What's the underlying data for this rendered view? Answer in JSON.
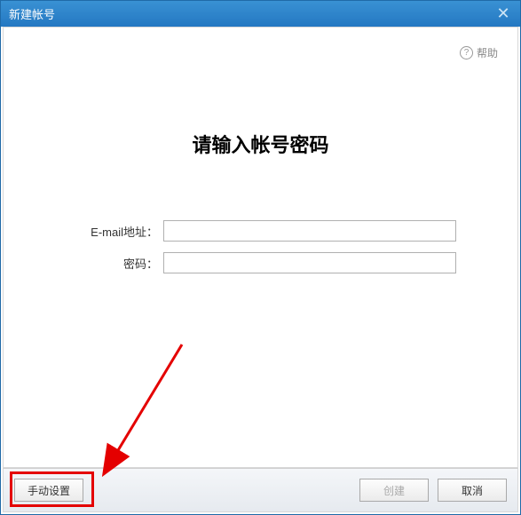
{
  "window": {
    "title": "新建帐号"
  },
  "help": {
    "label": "帮助"
  },
  "heading": "请输入帐号密码",
  "form": {
    "email_label": "E-mail地址：",
    "email_value": "",
    "password_label": "密码：",
    "password_value": ""
  },
  "buttons": {
    "manual": "手动设置",
    "create": "创建",
    "cancel": "取消"
  },
  "annotation": {
    "highlight_target": "manual-settings-button"
  }
}
